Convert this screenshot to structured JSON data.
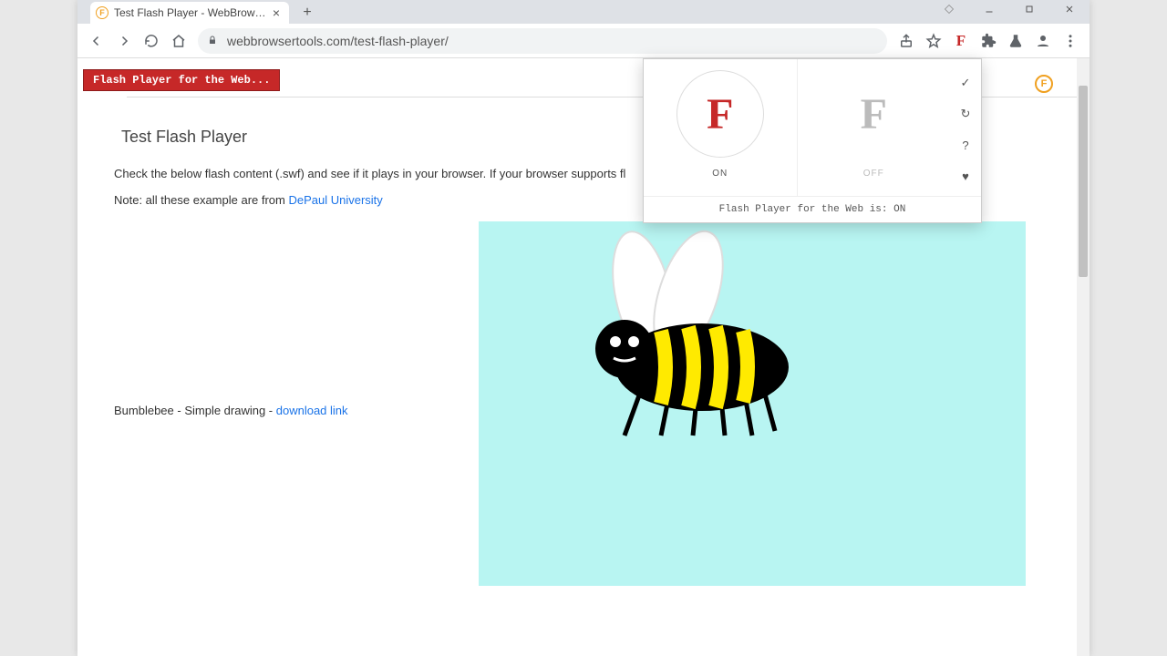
{
  "window_controls": {
    "min": "minimize",
    "max": "maximize",
    "close": "close"
  },
  "tab": {
    "title": "Test Flash Player - WebBrowserT",
    "favicon_letter": "F"
  },
  "toolbar": {
    "url": "webbrowsertools.com/test-flash-player/"
  },
  "ext_badge": "Flash Player for the Web...",
  "page": {
    "title": "Test Flash Player",
    "intro": "Check the below flash content (.swf) and see if it plays in your browser. If your browser supports fl",
    "note_prefix": "Note: all these example are from ",
    "note_link": "DePaul University",
    "caption_prefix": "Bumblebee - Simple drawing - ",
    "caption_link": "download link",
    "right_icon_letter": "F"
  },
  "popup": {
    "on_letter": "F",
    "off_letter": "F",
    "on_label": "ON",
    "off_label": "OFF",
    "status": "Flash Player for the Web is: ON"
  }
}
